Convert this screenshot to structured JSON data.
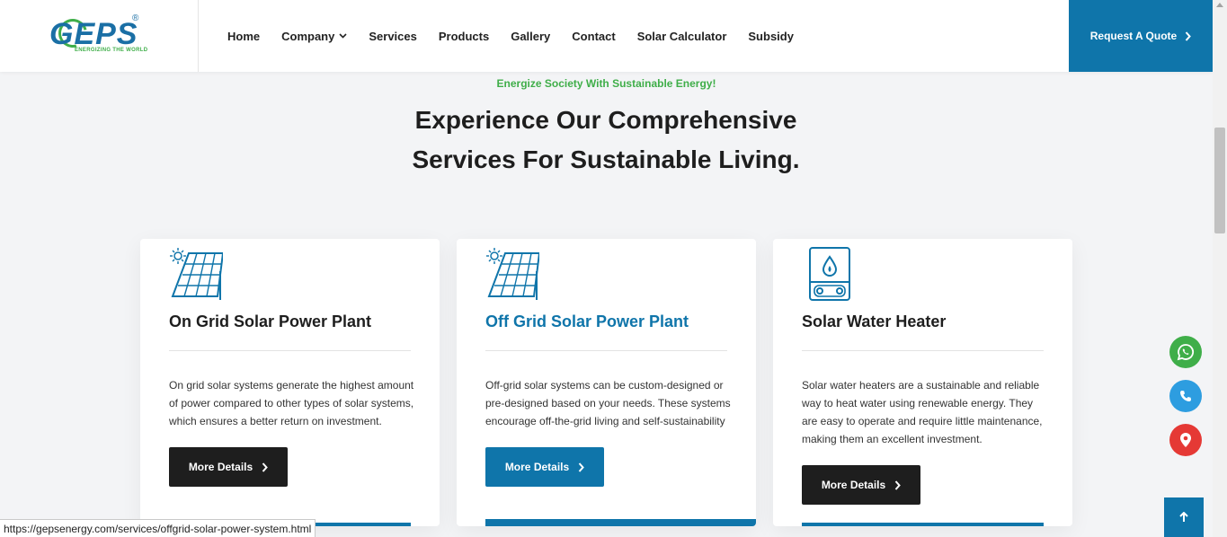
{
  "brand": {
    "name": "GEPS",
    "registered_mark": "®",
    "tagline": "ENERGIZING THE WORLD"
  },
  "nav": {
    "items": [
      {
        "label": "Home"
      },
      {
        "label": "Company",
        "has_dropdown": true
      },
      {
        "label": "Services"
      },
      {
        "label": "Products"
      },
      {
        "label": "Gallery"
      },
      {
        "label": "Contact"
      },
      {
        "label": "Solar Calculator"
      },
      {
        "label": "Subsidy"
      }
    ],
    "quote_button": "Request A Quote"
  },
  "section": {
    "tagline": "Energize Society With Sustainable Energy!",
    "heading": "Experience Our Comprehensive Services For Sustainable Living."
  },
  "cards": [
    {
      "icon": "solar-panel-icon",
      "title": "On Grid Solar Power Plant",
      "description": "On grid solar systems generate the highest amount of power compared to other types of solar systems, which ensures a better return on investment.",
      "button": "More Details"
    },
    {
      "icon": "solar-panel-icon",
      "title": "Off Grid Solar Power Plant",
      "description": "Off-grid solar systems can be custom-designed or pre-designed based on your needs. These systems encourage off-the-grid living and self-sustainability",
      "button": "More Details"
    },
    {
      "icon": "water-heater-icon",
      "title": "Solar Water Heater",
      "description": "Solar water heaters are a sustainable and reliable way to heat water using renewable energy. They are easy to operate and require little maintenance, making them an excellent investment.",
      "button": "More Details"
    }
  ],
  "floating": {
    "whatsapp": "whatsapp-icon",
    "phone": "phone-icon",
    "location": "location-pin-icon",
    "scroll_top": "arrow-up-icon"
  },
  "status_bar": {
    "url": "https://gepsenergy.com/services/offgrid-solar-power-system.html"
  },
  "colors": {
    "primary": "#0f75aa",
    "accent_green": "#3fae49",
    "dark": "#1e1e1e",
    "location_red": "#e53935",
    "phone_blue": "#2d9de0"
  }
}
